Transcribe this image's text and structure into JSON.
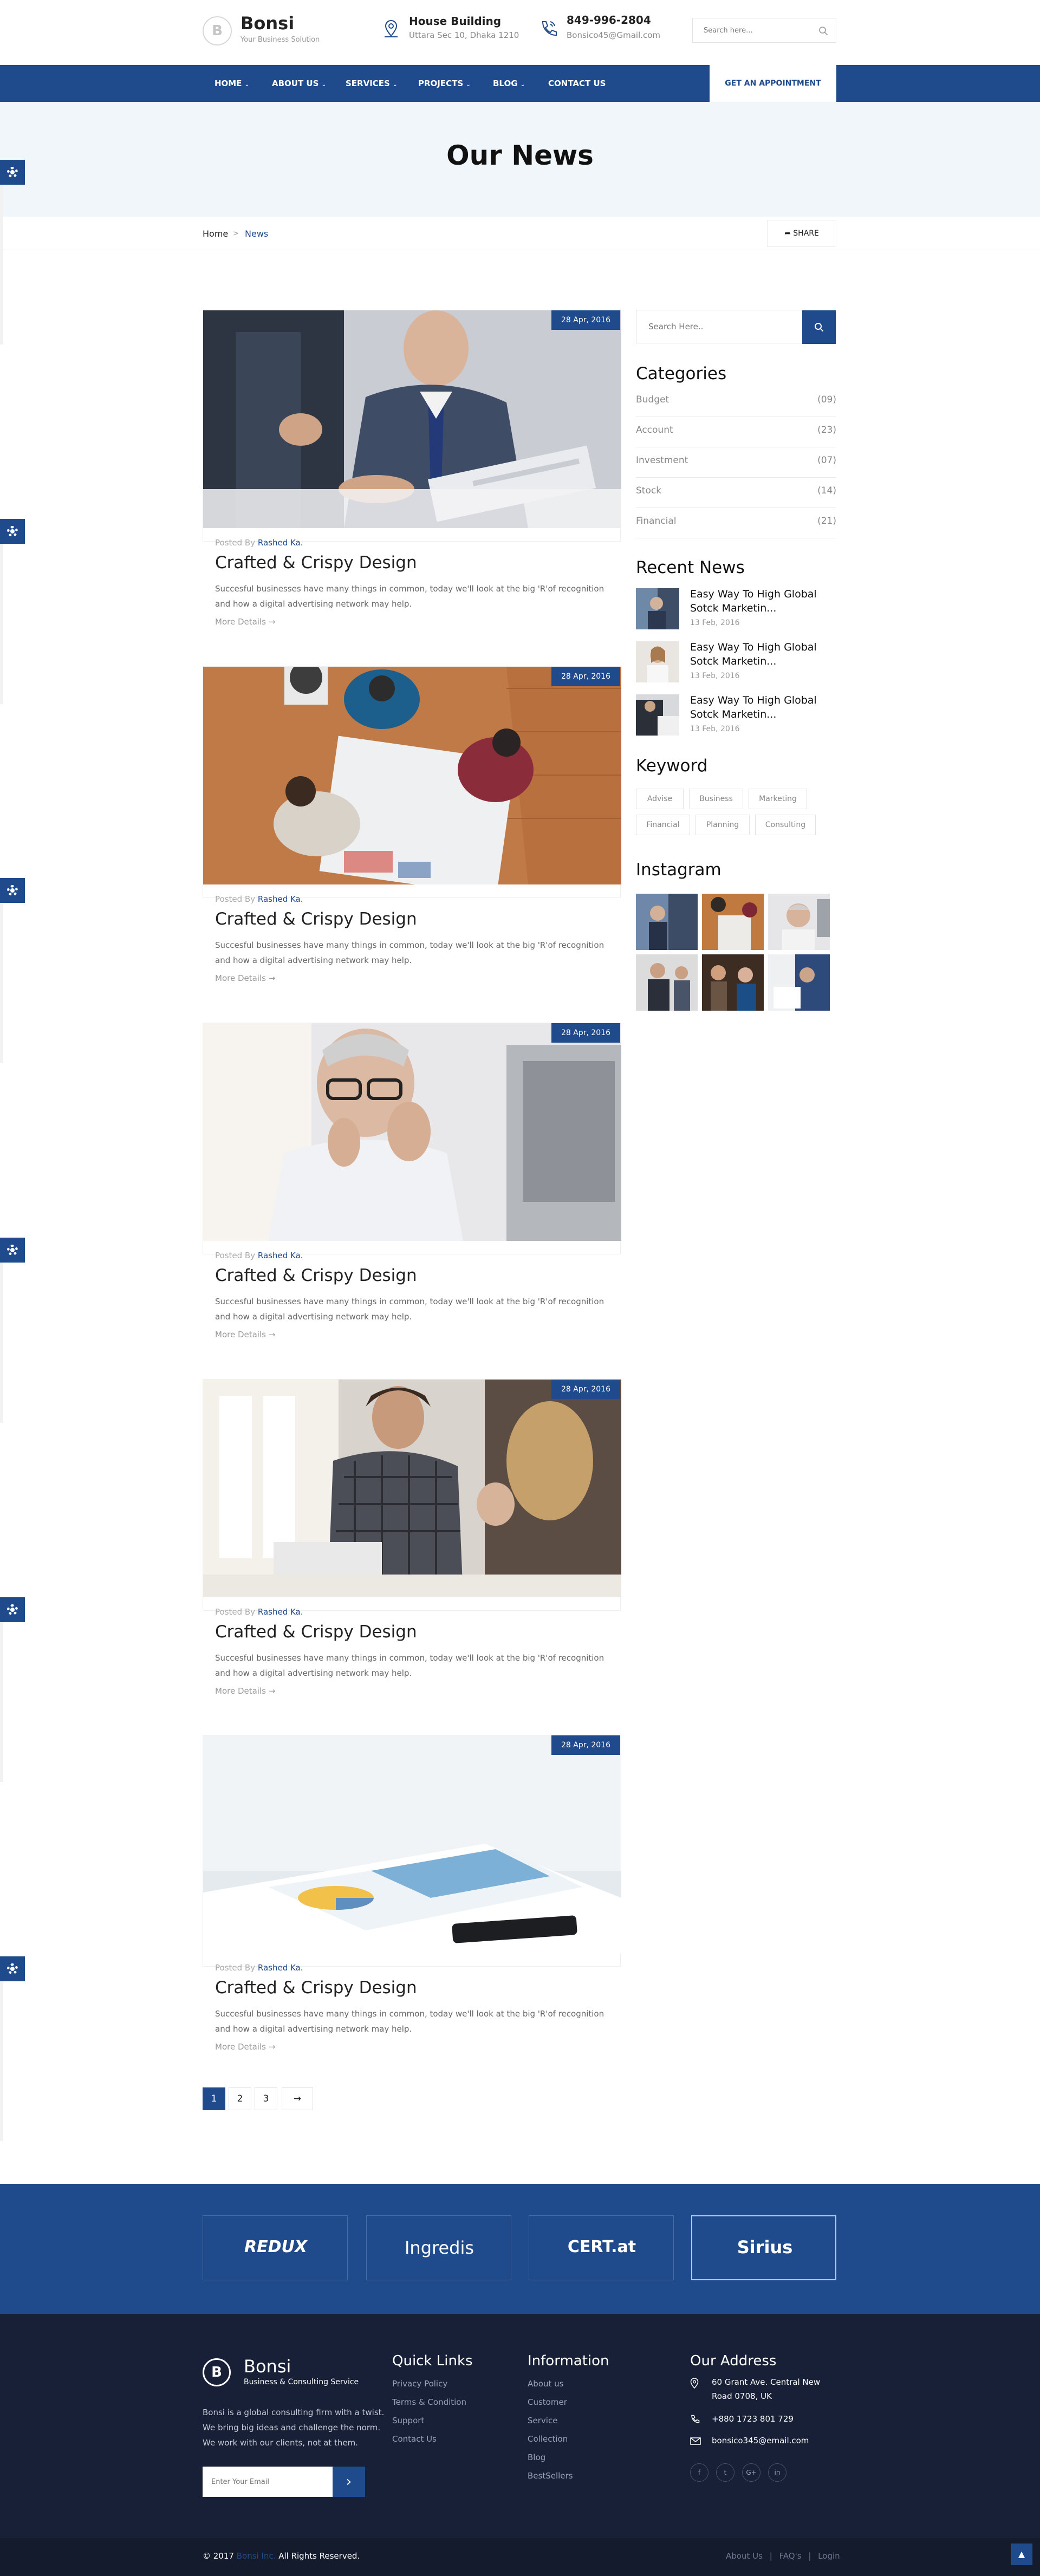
{
  "brand": {
    "name": "Bonsi",
    "tagline": "Your Business Solution",
    "logo_letter": "B"
  },
  "header": {
    "info1": {
      "title": "House Building",
      "sub": "Uttara Sec 10, Dhaka 1210"
    },
    "info2": {
      "title": "849-996-2804",
      "sub": "Bonsico45@Gmail.com"
    },
    "search_placeholder": "Search here..."
  },
  "nav": {
    "items": [
      "HOME",
      "ABOUT US",
      "SERVICES",
      "PROJECTS",
      "BLOG",
      "CONTACT US"
    ],
    "cta": "GET AN APPOINTMENT"
  },
  "page": {
    "title": "Our News"
  },
  "breadcrumb": {
    "home": "Home",
    "sep": ">",
    "current": "News",
    "share": "SHARE"
  },
  "posts": [
    {
      "date": "28 Apr, 2016",
      "posted_by": "Posted By",
      "author": "Rashed Ka.",
      "title": "Crafted & Crispy Design",
      "excerpt": "Succesful businesses have many things in common, today we'll look at the big 'R'of recognition and how a digital advertising network may help.",
      "more": "More Details"
    },
    {
      "date": "28 Apr, 2016",
      "posted_by": "Posted By",
      "author": "Rashed Ka.",
      "title": "Crafted & Crispy Design",
      "excerpt": "Succesful businesses have many things in common, today we'll look at the big 'R'of recognition and how a digital advertising network may help.",
      "more": "More Details"
    },
    {
      "date": "28 Apr, 2016",
      "posted_by": "Posted By",
      "author": "Rashed Ka.",
      "title": "Crafted & Crispy Design",
      "excerpt": "Succesful businesses have many things in common, today we'll look at the big 'R'of recognition and how a digital advertising network may help.",
      "more": "More Details"
    },
    {
      "date": "28 Apr, 2016",
      "posted_by": "Posted By",
      "author": "Rashed Ka.",
      "title": "Crafted & Crispy Design",
      "excerpt": "Succesful businesses have many things in common, today we'll look at the big 'R'of recognition and how a digital advertising network may help.",
      "more": "More Details"
    },
    {
      "date": "28 Apr, 2016",
      "posted_by": "Posted By",
      "author": "Rashed Ka.",
      "title": "Crafted & Crispy Design",
      "excerpt": "Succesful businesses have many things in common, today we'll look at the big 'R'of recognition and how a digital advertising network may help.",
      "more": "More Details"
    }
  ],
  "sidebar": {
    "search_placeholder": "Search Here..",
    "categories_title": "Categories",
    "categories": [
      {
        "label": "Budget",
        "count": "(09)"
      },
      {
        "label": "Account",
        "count": "(23)"
      },
      {
        "label": "Investment",
        "count": "(07)"
      },
      {
        "label": "Stock",
        "count": "(14)"
      },
      {
        "label": "Financial",
        "count": "(21)"
      }
    ],
    "recent_title": "Recent News",
    "recent": [
      {
        "title": "Easy Way To High Global Sotck Marketin...",
        "date": "13 Feb, 2016"
      },
      {
        "title": "Easy Way To High Global Sotck Marketin...",
        "date": "13 Feb, 2016"
      },
      {
        "title": "Easy Way To High Global Sotck Marketin...",
        "date": "13 Feb, 2016"
      }
    ],
    "keyword_title": "Keyword",
    "keywords": [
      "Advise",
      "Business",
      "Marketing",
      "Financial",
      "Planning",
      "Consulting"
    ],
    "instagram_title": "Instagram"
  },
  "pagination": {
    "pages": [
      "1",
      "2",
      "3"
    ],
    "next": "→",
    "active": 0
  },
  "partners": [
    "REDUX",
    "Ingredis",
    "CERT.at",
    "Sirius"
  ],
  "footer": {
    "brand_name": "Bonsi",
    "brand_sub": "Business & Consulting Service",
    "about": [
      "Bonsi is a global consulting firm with a twist.",
      "We bring big ideas and challenge the norm.",
      "We work with our clients, not at them."
    ],
    "email_placeholder": "Enter Your Email",
    "quick_links_title": "Quick Links",
    "quick_links": [
      "Privacy Policy",
      "Terms & Condition",
      "Support",
      "Contact Us"
    ],
    "info_title": "Information",
    "info_links": [
      "About us",
      "Customer",
      "Service",
      "Collection",
      "Blog",
      "BestSellers"
    ],
    "address_title": "Our Address",
    "address_lines": [
      "60 Grant Ave. Central New",
      "Road 0708, UK"
    ],
    "phone": "+880 1723 801 729",
    "email": "bonsico345@email.com",
    "social": [
      "f",
      "t",
      "G+",
      "in"
    ]
  },
  "copyright": {
    "prefix": "© 2017",
    "brand": "Bonsi Inc.",
    "suffix": "All Rights Reserved.",
    "links": [
      "About Us",
      "FAQ's",
      "Login"
    ]
  },
  "colors": {
    "primary": "#1f4a8c",
    "footer_bg": "#172036",
    "title_band": "#f1f6fa"
  }
}
